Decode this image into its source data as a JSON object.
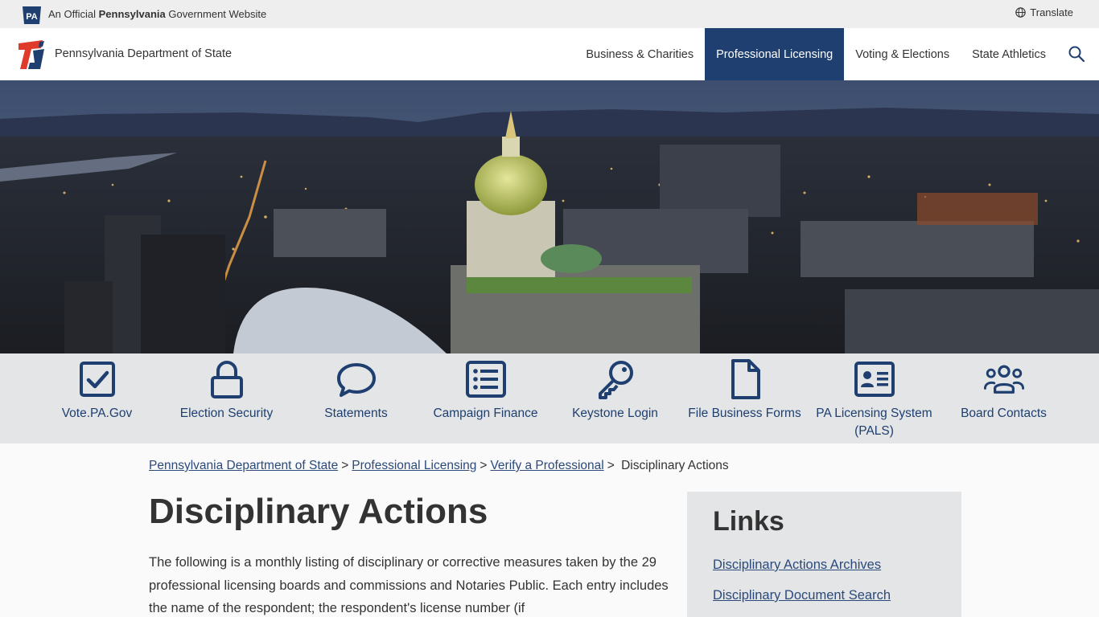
{
  "gov_bar": {
    "badge": "PA",
    "prefix": "An Official",
    "state": "Pennsylvania",
    "suffix": "Government Website",
    "translate": "Translate"
  },
  "header": {
    "agency": "Pennsylvania Department of State",
    "nav": [
      {
        "label": "Business & Charities",
        "active": false
      },
      {
        "label": "Professional Licensing",
        "active": true
      },
      {
        "label": "Voting & Elections",
        "active": false
      },
      {
        "label": "State Athletics",
        "active": false
      }
    ]
  },
  "quick_links": [
    {
      "label": "Vote.PA.Gov",
      "icon": "checkbox-icon"
    },
    {
      "label": "Election Security",
      "icon": "lock-icon"
    },
    {
      "label": "Statements",
      "icon": "speech-bubble-icon"
    },
    {
      "label": "Campaign Finance",
      "icon": "list-icon"
    },
    {
      "label": "Keystone Login",
      "icon": "key-icon"
    },
    {
      "label": "File Business Forms",
      "icon": "document-icon"
    },
    {
      "label": "PA Licensing System (PALS)",
      "icon": "id-card-icon"
    },
    {
      "label": "Board Contacts",
      "icon": "users-icon"
    }
  ],
  "breadcrumb": {
    "items": [
      "Pennsylvania Department of State",
      "Professional Licensing",
      "Verify a Professional"
    ],
    "current": "Disciplinary Actions",
    "separator": ">"
  },
  "main": {
    "title": "Disciplinary Actions",
    "intro": "The following is a monthly listing of disciplinary or corrective measures taken by the 29 professional licensing boards and commissions and Notaries Public.  Each entry includes the name of the respondent; the respondent's license number (if"
  },
  "side": {
    "title": "Links",
    "links": [
      "Disciplinary Actions Archives",
      "Disciplinary Document Search"
    ]
  },
  "colors": {
    "brand_navy": "#1e3f6f",
    "link": "#2b4a7a",
    "logo_red": "#e03a2a",
    "quick_bg": "#e3e5e7"
  }
}
